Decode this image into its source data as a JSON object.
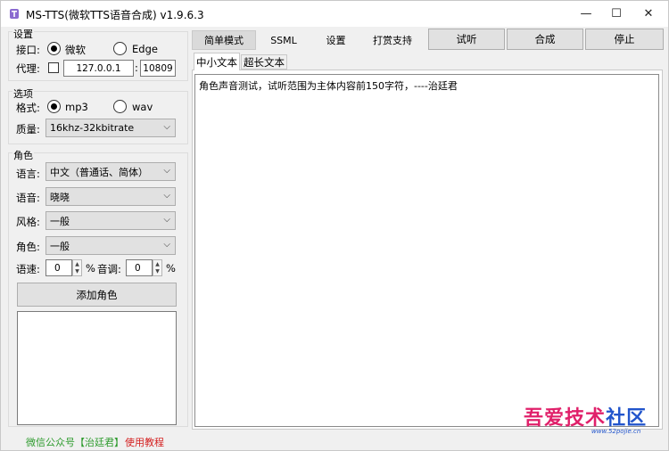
{
  "window": {
    "title": "MS-TTS(微软TTS语音合成) v1.9.6.3",
    "controls": {
      "minimize": "—",
      "maximize": "☐",
      "close": "✕"
    }
  },
  "settings": {
    "title": "设置",
    "interface_label": "接口:",
    "option_microsoft": "微软",
    "option_edge": "Edge",
    "proxy_label": "代理:",
    "proxy_host": "127.0.0.1",
    "proxy_sep": ":",
    "proxy_port": "10809"
  },
  "options": {
    "title": "选项",
    "format_label": "格式:",
    "format_mp3": "mp3",
    "format_wav": "wav",
    "quality_label": "质量:",
    "quality_value": "16khz-32kbitrate"
  },
  "role": {
    "title": "角色",
    "language_label": "语言:",
    "language_value": "中文（普通话、简体）",
    "voice_label": "语音:",
    "voice_value": "晓晓",
    "style_label": "风格:",
    "style_value": "一般",
    "role_label": "角色:",
    "role_value": "一般",
    "rate_label": "语速:",
    "rate_value": "0",
    "rate_unit": "%",
    "pitch_label": "音调:",
    "pitch_value": "0",
    "pitch_unit": "%",
    "add_role_button": "添加角色"
  },
  "tabs": [
    {
      "label": "简单模式",
      "active": true
    },
    {
      "label": "SSML",
      "active": false
    },
    {
      "label": "设置",
      "active": false
    },
    {
      "label": "打赏支持",
      "active": false
    }
  ],
  "actions": {
    "preview": "试听",
    "synthesize": "合成",
    "stop": "停止"
  },
  "subtabs": [
    {
      "label": "中小文本",
      "active": true
    },
    {
      "label": "超长文本",
      "active": false
    }
  ],
  "editor": {
    "text": "角色声音测试，试听范围为主体内容前150字符，----治廷君"
  },
  "footer": {
    "wechat_link": "微信公众号【治廷君】",
    "help_link": "使用教程",
    "wechat_color": "#2e9b2e",
    "help_color": "#d42020"
  },
  "watermark": {
    "text": "吾爱技术社区",
    "url": "www.52pojie.cn",
    "colors": [
      "#e0206a",
      "#2255cc"
    ]
  }
}
